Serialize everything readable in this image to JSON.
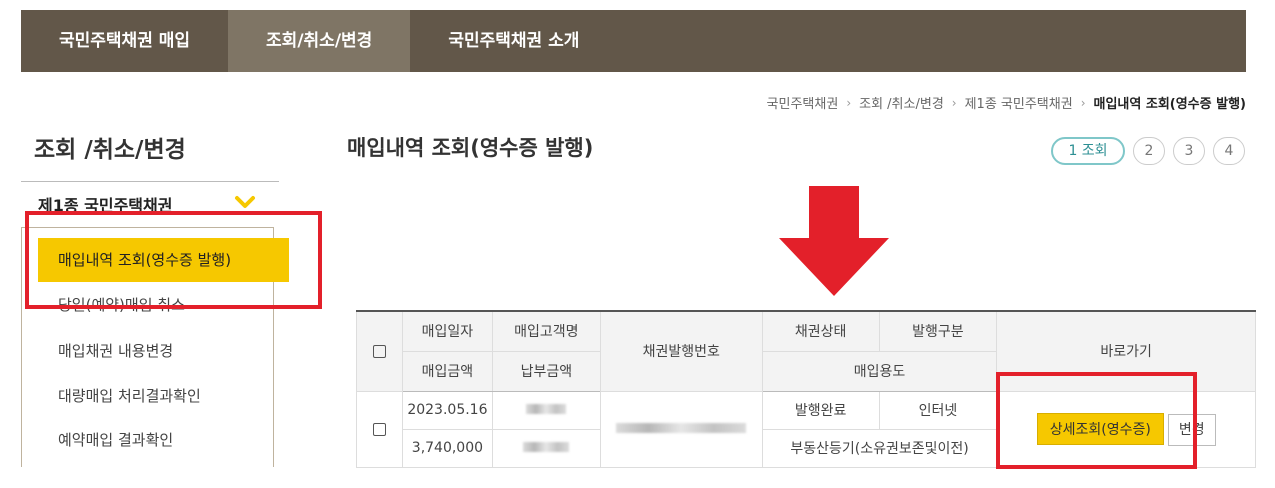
{
  "topnav": {
    "items": [
      {
        "label": "국민주택채권 매입"
      },
      {
        "label": "조회/취소/변경"
      },
      {
        "label": "국민주택채권 소개"
      }
    ]
  },
  "breadcrumb": {
    "items": [
      "국민주택채권",
      "조회 /취소/변경",
      "제1종 국민주택채권"
    ],
    "current": "매입내역 조회(영수증 발행)"
  },
  "sidebar": {
    "title": "조회 /취소/변경",
    "group": "제1종 국민주택채권",
    "items": [
      {
        "label": "매입내역 조회(영수증 발행)"
      },
      {
        "label": "당일(예약)매입 취소"
      },
      {
        "label": "매입채권 내용변경"
      },
      {
        "label": "대량매입 처리결과확인"
      },
      {
        "label": "예약매입 결과확인"
      }
    ]
  },
  "main": {
    "title": "매입내역 조회(영수증 발행)",
    "steps": [
      "1 조회",
      "2",
      "3",
      "4"
    ]
  },
  "table": {
    "headers": {
      "purchase_date": "매입일자",
      "customer": "매입고객명",
      "bond_no": "채권발행번호",
      "bond_status": "채권상태",
      "issue_type": "발행구분",
      "shortcut": "바로가기",
      "amount": "매입금액",
      "paid": "납부금액",
      "purpose": "매입용도"
    },
    "rows": [
      {
        "date": "2023.05.16",
        "amount": "3,740,000",
        "status": "발행완료",
        "issue_type": "인터넷",
        "purpose": "부동산등기(소유권보존및이전)",
        "detail_button": "상세조회(영수증)",
        "change_button": "변경"
      }
    ]
  },
  "colors": {
    "nav_bg": "#625749",
    "nav_active": "#7f7565",
    "accent_yellow": "#f6c800",
    "highlight_red": "#e3202a"
  }
}
